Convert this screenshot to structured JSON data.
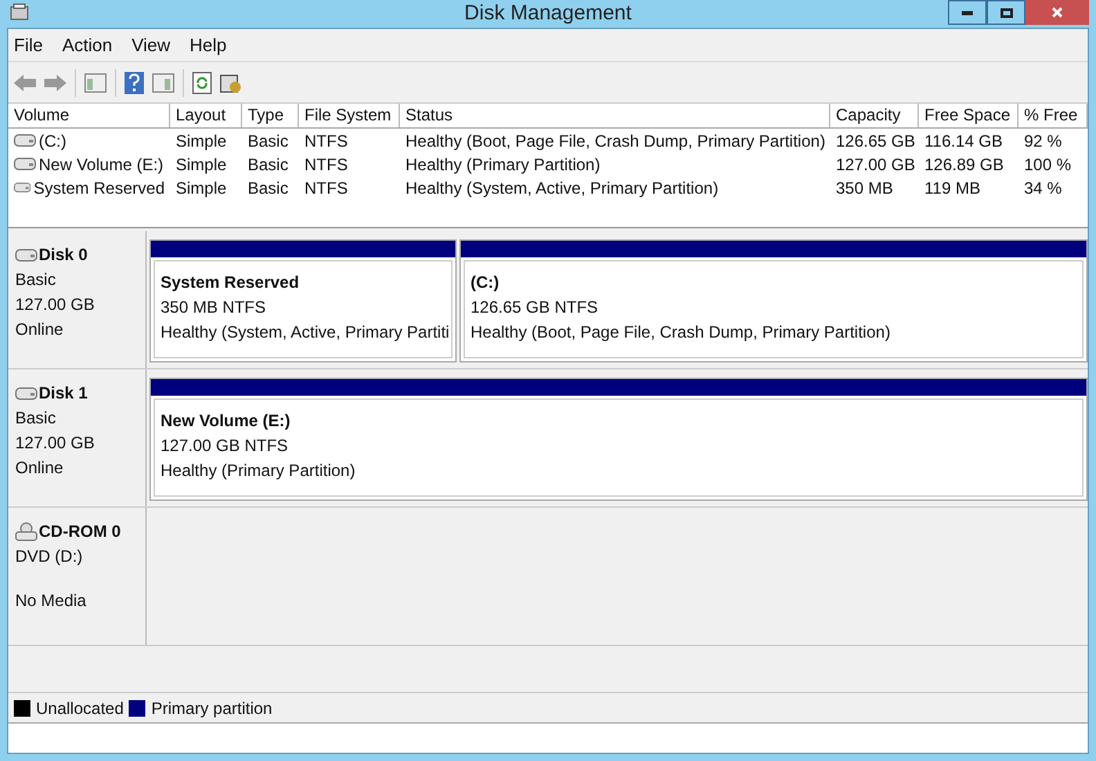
{
  "window": {
    "title": "Disk Management"
  },
  "menu": [
    "File",
    "Action",
    "View",
    "Help"
  ],
  "table": {
    "columns": [
      "Volume",
      "Layout",
      "Type",
      "File System",
      "Status",
      "Capacity",
      "Free Space",
      "% Free"
    ],
    "rows": [
      [
        "(C:)",
        "Simple",
        "Basic",
        "NTFS",
        "Healthy (Boot, Page File, Crash Dump, Primary Partition)",
        "126.65 GB",
        "116.14 GB",
        "92 %"
      ],
      [
        "New Volume (E:)",
        "Simple",
        "Basic",
        "NTFS",
        "Healthy (Primary Partition)",
        "127.00 GB",
        "126.89 GB",
        "100 %"
      ],
      [
        "System Reserved",
        "Simple",
        "Basic",
        "NTFS",
        "Healthy (System, Active, Primary Partition)",
        "350 MB",
        "119 MB",
        "34 %"
      ]
    ]
  },
  "disks": [
    {
      "kind": "disk",
      "name": "Disk 0",
      "lines": [
        "Basic",
        "127.00 GB",
        "Online"
      ],
      "partitions": [
        {
          "name": "System Reserved",
          "size": "350 MB NTFS",
          "status": "Healthy (System, Active, Primary Partiti",
          "color": "#00007f"
        },
        {
          "name": "(C:)",
          "size": "126.65 GB NTFS",
          "status": "Healthy (Boot, Page File, Crash Dump, Primary Partition)",
          "color": "#00007f"
        }
      ]
    },
    {
      "kind": "disk",
      "name": "Disk 1",
      "lines": [
        "Basic",
        "127.00 GB",
        "Online"
      ],
      "partitions": [
        {
          "name": "New Volume  (E:)",
          "size": "127.00 GB NTFS",
          "status": "Healthy (Primary Partition)",
          "color": "#00007f"
        }
      ]
    },
    {
      "kind": "cdrom",
      "name": "CD-ROM 0",
      "lines": [
        "DVD (D:)",
        "No Media"
      ]
    }
  ],
  "legend": [
    {
      "label": "Unallocated",
      "color": "#000000"
    },
    {
      "label": "Primary partition",
      "color": "#00007f"
    }
  ]
}
